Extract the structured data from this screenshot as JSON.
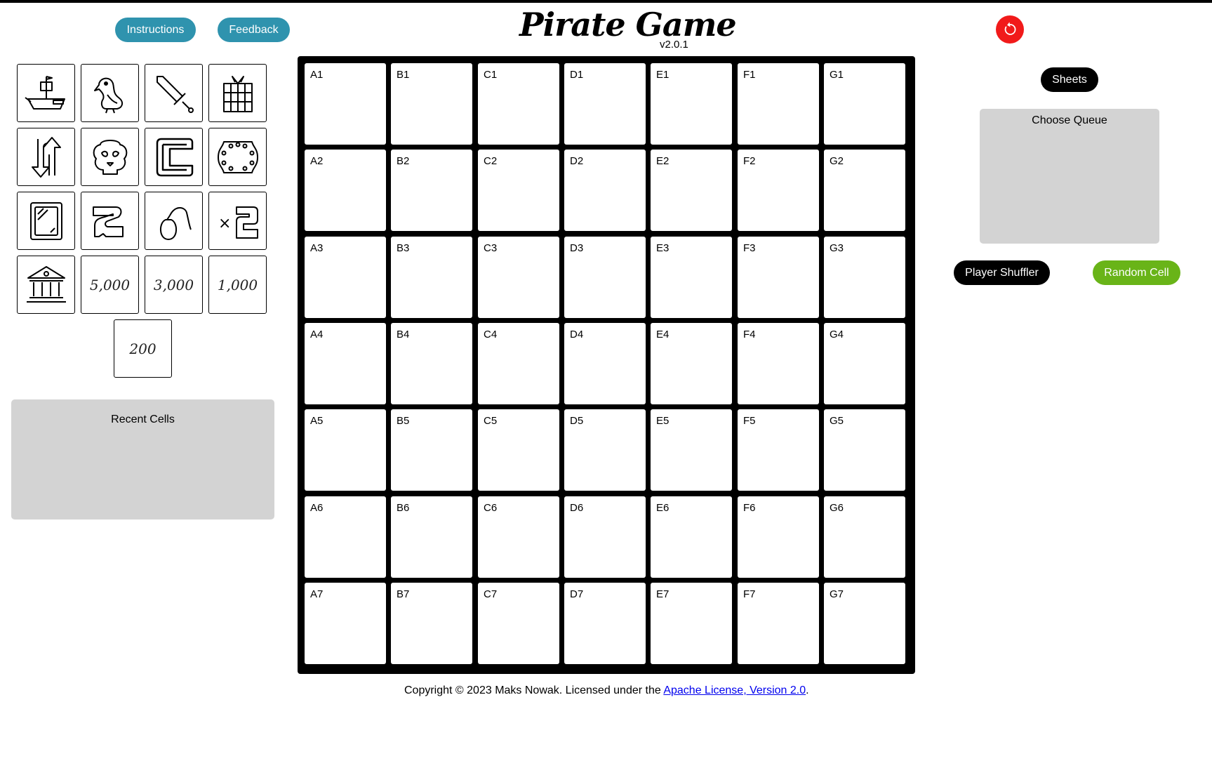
{
  "header": {
    "instructions_label": "Instructions",
    "feedback_label": "Feedback",
    "title": "Pirate Game",
    "version": "v2.0.1",
    "reset_icon": "reset-icon",
    "reset_color": "#f11a1a"
  },
  "tiles": [
    {
      "icon": "pirate-ship-icon"
    },
    {
      "icon": "parrot-icon"
    },
    {
      "icon": "sword-icon"
    },
    {
      "icon": "present-icon"
    },
    {
      "icon": "swap-icon"
    },
    {
      "icon": "skull-icon"
    },
    {
      "icon": "choose-icon"
    },
    {
      "icon": "shield-icon"
    },
    {
      "icon": "mirror-icon"
    },
    {
      "icon": "bomb-icon"
    },
    {
      "icon": "sneak-icon"
    },
    {
      "icon": "double-icon",
      "label": "×2"
    },
    {
      "icon": "bank-icon"
    },
    {
      "icon": "money-5000",
      "label": "5,000"
    },
    {
      "icon": "money-3000",
      "label": "3,000"
    },
    {
      "icon": "money-1000",
      "label": "1,000"
    },
    {
      "icon": "money-200",
      "label": "200"
    }
  ],
  "recent_cells": {
    "title": "Recent Cells"
  },
  "right_panel": {
    "sheets_label": "Sheets",
    "choose_queue_title": "Choose Queue",
    "player_shuffler_label": "Player Shuffler",
    "random_cell_label": "Random Cell"
  },
  "board": {
    "columns": [
      "A",
      "B",
      "C",
      "D",
      "E",
      "F",
      "G"
    ],
    "rows": [
      "1",
      "2",
      "3",
      "4",
      "5",
      "6",
      "7"
    ]
  },
  "footer": {
    "text": "Copyright © 2023 Maks Nowak. Licensed under the ",
    "link_text": "Apache License, Version 2.0",
    "suffix": "."
  },
  "colors": {
    "teal": "#2f93ae",
    "green": "#69b418",
    "panel_gray": "#d3d3d3"
  }
}
